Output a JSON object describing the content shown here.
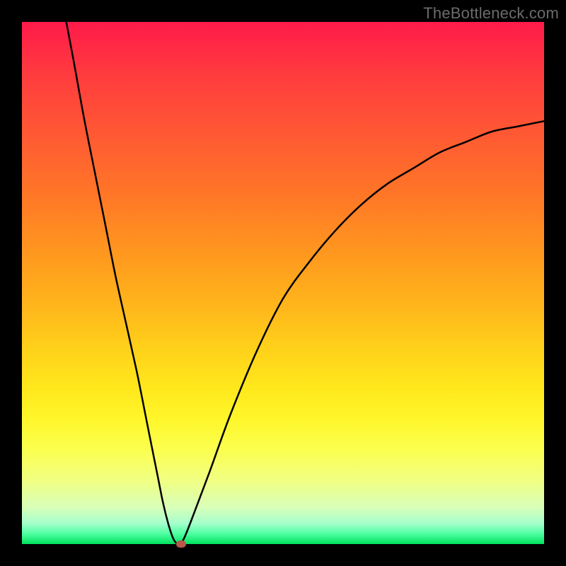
{
  "attribution": "TheBottleneck.com",
  "colors": {
    "curve_stroke": "#000000",
    "marker_fill": "#b7584b",
    "frame_bg": "#000000"
  },
  "chart_data": {
    "type": "line",
    "title": "",
    "xlabel": "",
    "ylabel": "",
    "xlim": [
      0,
      100
    ],
    "ylim": [
      0,
      100
    ],
    "x": [
      8.5,
      10,
      12,
      14,
      16,
      18,
      20,
      22,
      24,
      26,
      27,
      28,
      29,
      30,
      31,
      33,
      36,
      40,
      45,
      50,
      55,
      60,
      65,
      70,
      75,
      80,
      85,
      90,
      95,
      100
    ],
    "values": [
      100,
      92,
      81,
      71,
      61,
      51,
      42,
      33,
      23,
      13,
      8,
      4,
      1,
      0,
      1,
      6,
      14,
      25,
      37,
      47,
      54,
      60,
      65,
      69,
      72,
      75,
      77,
      79,
      80,
      81
    ],
    "marker": {
      "x": 30.5,
      "y": 0
    },
    "note": "Values are percentage heights read from the plot; x is relative horizontal position. Chart has no visible axis ticks or labels."
  }
}
